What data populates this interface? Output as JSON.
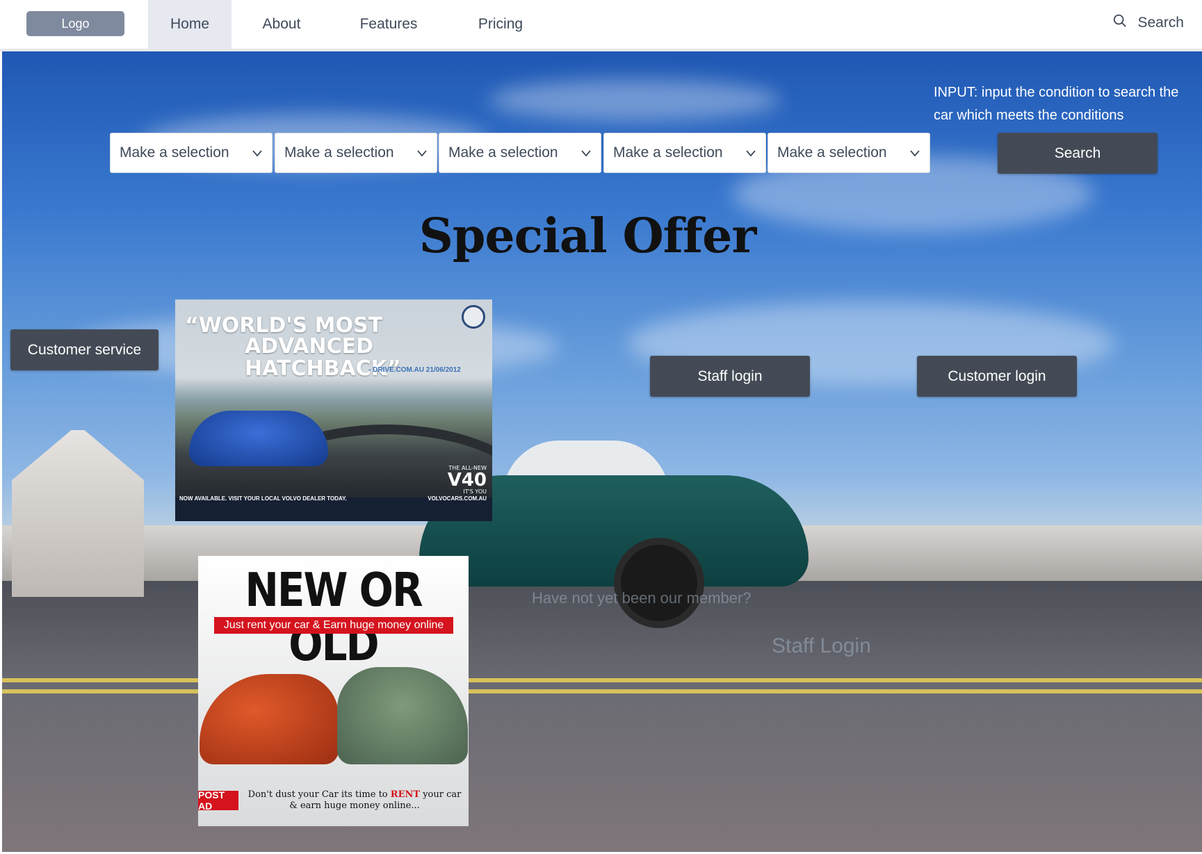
{
  "nav": {
    "logo": "Logo",
    "items": [
      "Home",
      "About",
      "Features",
      "Pricing"
    ],
    "active": "Home",
    "search_label": "Search"
  },
  "search_bar": {
    "hint": "INPUT: input the condition to search the car which meets the conditions",
    "selects": [
      "Make a selection",
      "Make a selection",
      "Make a selection",
      "Make a selection",
      "Make a selection"
    ],
    "search_button": "Search"
  },
  "hero": {
    "title": "Special Offer",
    "customer_service": "Customer service",
    "staff_login": "Staff login",
    "customer_login": "Customer login",
    "member_prompt": "Have not yet been our member?",
    "staff_login_faded": "Staff Login"
  },
  "ads": {
    "volvo": {
      "quote_line1": "WORLD'S MOST",
      "quote_line2": "ADVANCED HATCHBACK",
      "source": "- DRIVE.COM.AU 21/06/2012",
      "model_top": "THE ALL-NEW",
      "model": "V40",
      "model_bottom": "IT'S YOU",
      "footer_left": "NOW AVAILABLE. VISIT YOUR LOCAL VOLVO DEALER TODAY.",
      "footer_right": "VOLVOCARS.COM.AU"
    },
    "rent": {
      "headline": "NEW OR OLD",
      "banner": "Just rent your car & Earn huge money online",
      "post_ad": "POST AD",
      "tagline_before": "Don't dust your Car its time to ",
      "tagline_highlight": "RENT",
      "tagline_after": " your car & earn huge money online..."
    }
  },
  "colors": {
    "button_bg": "#434a55",
    "nav_text": "#3f4a5a",
    "logo_bg": "#7f8a9e",
    "active_tab_bg": "#e6e9ef",
    "ad_red": "#d4131d"
  }
}
